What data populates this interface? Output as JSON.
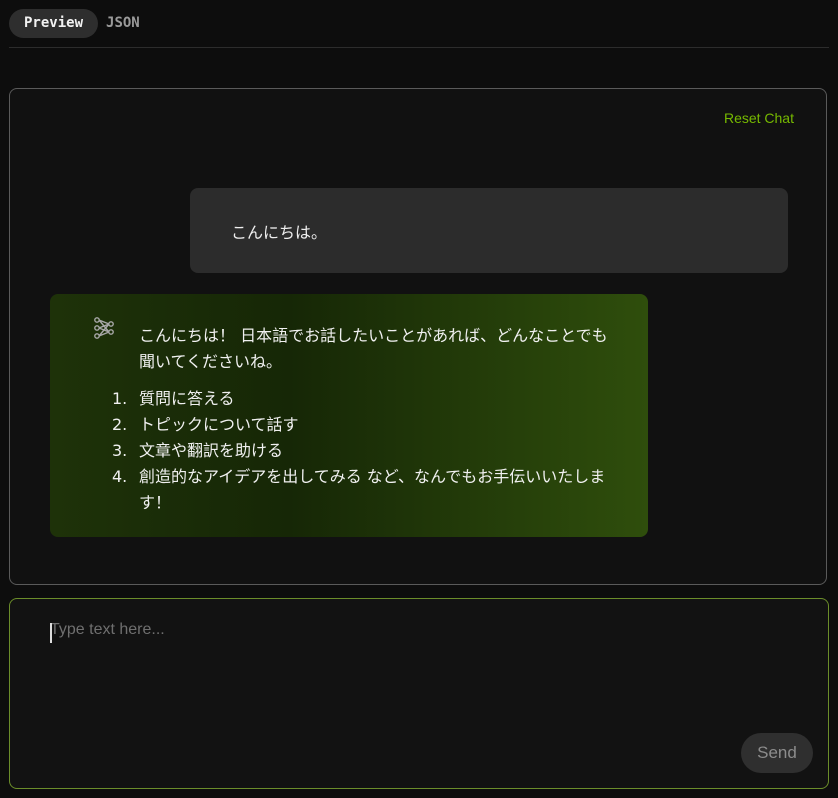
{
  "tabs": [
    {
      "label": "Preview",
      "active": true
    },
    {
      "label": "JSON",
      "active": false
    }
  ],
  "chat": {
    "reset_label": "Reset Chat",
    "user_message": "こんにちは。",
    "bot_intro": "こんにちは！ 日本語でお話したいことがあれば、どんなことでも聞いてくださいね。",
    "bot_list": [
      {
        "num": "1.",
        "text": "質問に答える"
      },
      {
        "num": "2.",
        "text": "トピックについて話す"
      },
      {
        "num": "3.",
        "text": "文章や翻訳を助ける"
      },
      {
        "num": "4.",
        "text": "創造的なアイデアを出してみる など、なんでもお手伝いいたします！"
      }
    ],
    "bot_icon": "neural-network-icon"
  },
  "input": {
    "placeholder": "Type text here...",
    "value": "",
    "send_label": "Send"
  },
  "colors": {
    "accent": "#76b900",
    "background": "#0d0d0d",
    "user_bubble": "#2c2c2c",
    "bot_bubble": "#1e3209"
  }
}
